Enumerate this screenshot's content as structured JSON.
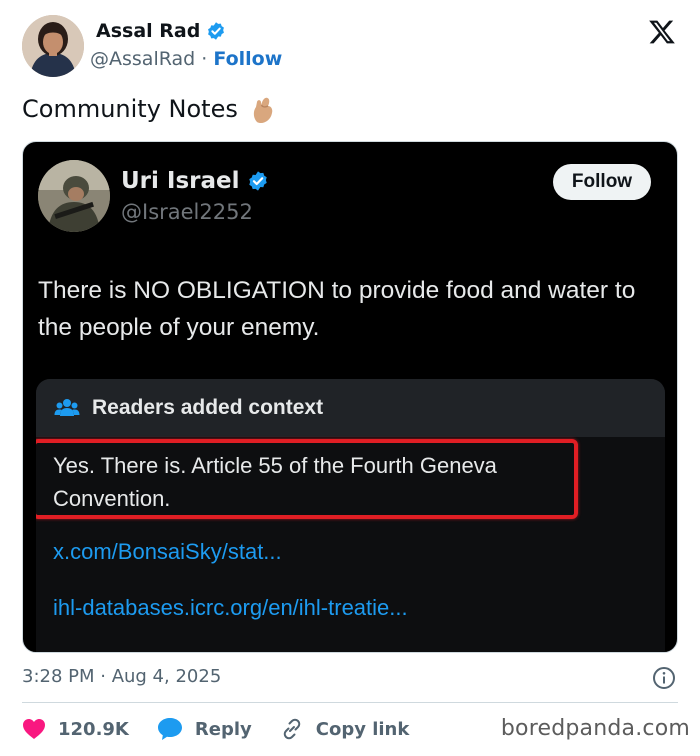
{
  "author": {
    "name": "Assal Rad",
    "handle": "@AssalRad",
    "separator": "·",
    "follow_label": "Follow"
  },
  "tweet": {
    "text": "Community Notes",
    "emoji_icon": "pinching-hand-icon"
  },
  "quoted": {
    "name": "Uri Israel",
    "handle": "@Israel2252",
    "follow_label": "Follow",
    "text": "There is NO OBLIGATION to provide food and water to the people of your enemy.",
    "notes": {
      "header": "Readers added context",
      "body": "Yes. There is. Article 55 of the Fourth Geneva Convention.",
      "links": [
        "x.com/BonsaiSky/stat...",
        "ihl-databases.icrc.org/en/ihl-treatie..."
      ]
    }
  },
  "meta": {
    "timestamp": "3:28 PM · Aug 4, 2025"
  },
  "actions": {
    "likes": "120.9K",
    "reply_label": "Reply",
    "copy_label": "Copy link"
  },
  "watermark": "boredpanda.com",
  "colors": {
    "accent": "#1d74c9",
    "verified": "#1d9bf0",
    "like": "#f91880",
    "highlight": "#e01e24"
  }
}
